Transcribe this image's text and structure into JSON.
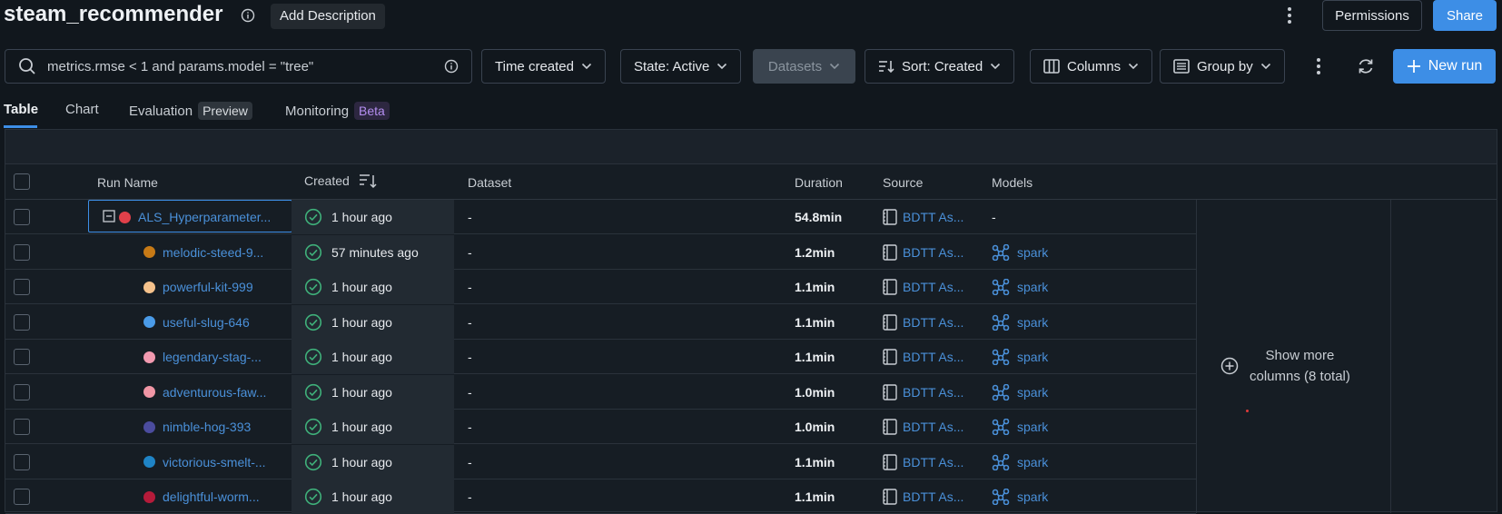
{
  "header": {
    "title": "steam_recommender",
    "add_description": "Add Description",
    "permissions": "Permissions",
    "share": "Share"
  },
  "toolbar": {
    "search_value": "metrics.rmse < 1 and params.model = \"tree\"",
    "time_created": "Time created",
    "state": "State: Active",
    "datasets": "Datasets",
    "sort": "Sort: Created",
    "columns": "Columns",
    "group_by": "Group by",
    "new_run": "New run"
  },
  "tabs": {
    "table": "Table",
    "chart": "Chart",
    "evaluation": "Evaluation",
    "evaluation_badge": "Preview",
    "monitoring": "Monitoring",
    "monitoring_badge": "Beta"
  },
  "table": {
    "headers": {
      "run_name": "Run Name",
      "created": "Created",
      "dataset": "Dataset",
      "duration": "Duration",
      "source": "Source",
      "models": "Models"
    },
    "rows": [
      {
        "name": "ALS_Hyperparameter...",
        "color": "#e0404a",
        "created": "1 hour ago",
        "dataset": "-",
        "duration": "54.8min",
        "source": "BDTT As...",
        "model": "-"
      },
      {
        "name": "melodic-steed-9...",
        "color": "#c77a16",
        "created": "57 minutes ago",
        "dataset": "-",
        "duration": "1.2min",
        "source": "BDTT As...",
        "model": "spark"
      },
      {
        "name": "powerful-kit-999",
        "color": "#f5c28c",
        "created": "1 hour ago",
        "dataset": "-",
        "duration": "1.1min",
        "source": "BDTT As...",
        "model": "spark"
      },
      {
        "name": "useful-slug-646",
        "color": "#4a9be8",
        "created": "1 hour ago",
        "dataset": "-",
        "duration": "1.1min",
        "source": "BDTT As...",
        "model": "spark"
      },
      {
        "name": "legendary-stag-...",
        "color": "#f29ab0",
        "created": "1 hour ago",
        "dataset": "-",
        "duration": "1.1min",
        "source": "BDTT As...",
        "model": "spark"
      },
      {
        "name": "adventurous-faw...",
        "color": "#f096a5",
        "created": "1 hour ago",
        "dataset": "-",
        "duration": "1.0min",
        "source": "BDTT As...",
        "model": "spark"
      },
      {
        "name": "nimble-hog-393",
        "color": "#4b4c9e",
        "created": "1 hour ago",
        "dataset": "-",
        "duration": "1.0min",
        "source": "BDTT As...",
        "model": "spark"
      },
      {
        "name": "victorious-smelt-...",
        "color": "#1f84c6",
        "created": "1 hour ago",
        "dataset": "-",
        "duration": "1.1min",
        "source": "BDTT As...",
        "model": "spark"
      },
      {
        "name": "delightful-worm...",
        "color": "#b51b3a",
        "created": "1 hour ago",
        "dataset": "-",
        "duration": "1.1min",
        "source": "BDTT As...",
        "model": "spark"
      }
    ],
    "show_more_line1": "Show more",
    "show_more_line2": "columns (8 total)"
  },
  "colors": {
    "accent": "#3d8ee6",
    "link": "#4a90d9",
    "success": "#3fb07a"
  }
}
